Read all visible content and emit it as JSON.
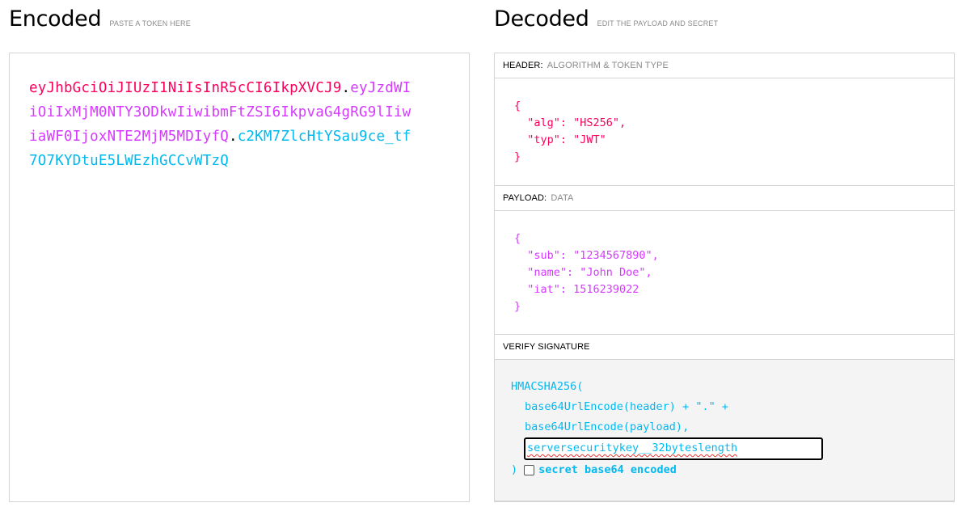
{
  "encoded": {
    "title": "Encoded",
    "subtitle": "PASTE A TOKEN HERE",
    "token_header": "eyJhbGciOiJIUzI1NiIsInR5cCI6IkpXVCJ9",
    "token_payload": "eyJzdWIiOiIxMjM0NTY3ODkwIiwibmFtZSI6IkpvaG4gRG9lIiwiaWF0IjoxNTE2MjM5MDIyfQ",
    "token_signature": "c2KM7ZlcHtYSau9ce_tf7O7KYDtuE5LWEzhGCCvWTzQ",
    "dot": "."
  },
  "decoded": {
    "title": "Decoded",
    "subtitle": "EDIT THE PAYLOAD AND SECRET",
    "header_section": {
      "label": "HEADER:",
      "hint": "ALGORITHM & TOKEN TYPE",
      "json": "{\n  \"alg\": \"HS256\",\n  \"typ\": \"JWT\"\n}"
    },
    "payload_section": {
      "label": "PAYLOAD:",
      "hint": "DATA",
      "json": "{\n  \"sub\": \"1234567890\",\n  \"name\": \"John Doe\",\n  \"iat\": 1516239022\n}"
    },
    "verify_section": {
      "label": "VERIFY SIGNATURE",
      "line1": "HMACSHA256(",
      "line2": "base64UrlEncode(header) + \".\" +",
      "line3": "base64UrlEncode(payload),",
      "secret_value": "serversecuritykey__32byteslength",
      "close_paren": ")",
      "secret_checkbox_label": "secret base64 encoded"
    }
  },
  "colors": {
    "header": "#fb015b",
    "payload": "#d63aff",
    "signature": "#00b9f1"
  }
}
